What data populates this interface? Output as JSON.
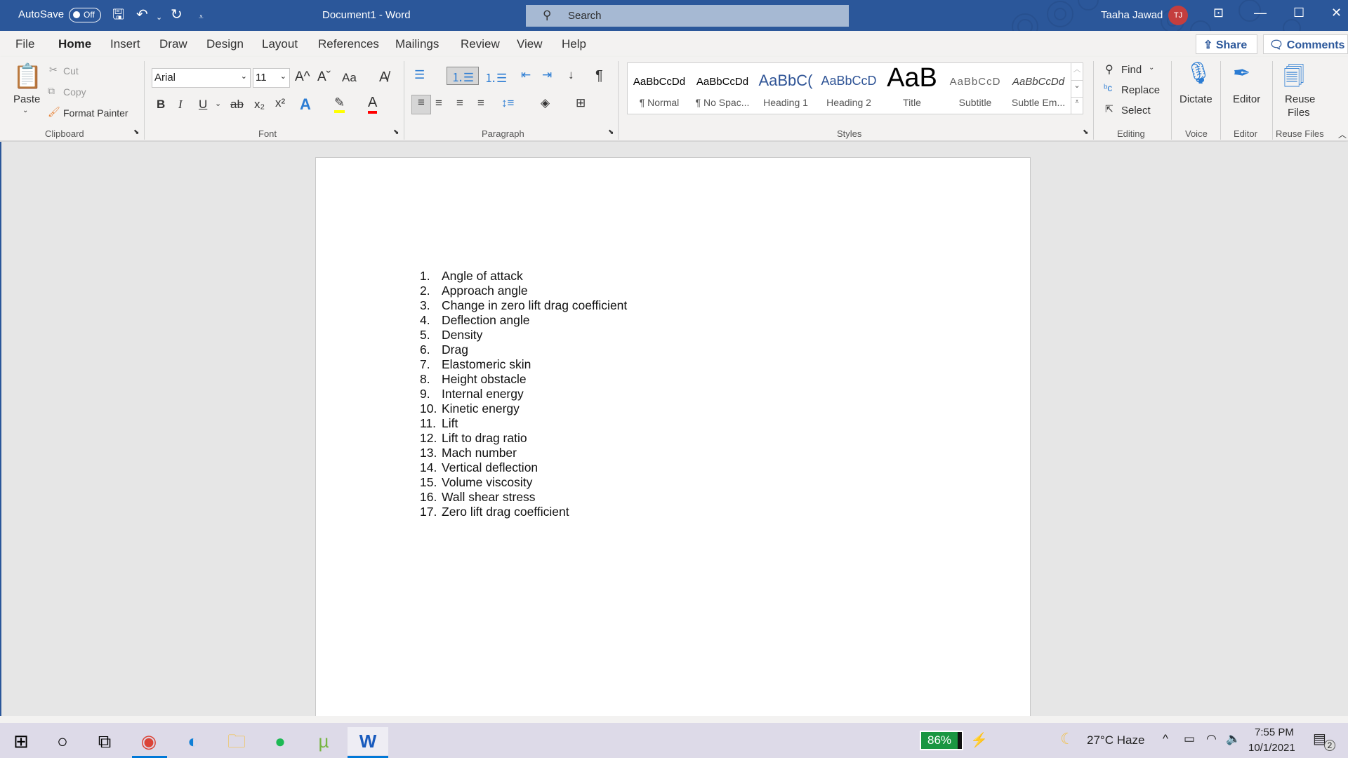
{
  "titlebar": {
    "autosave_label": "AutoSave",
    "autosave_state": "Off",
    "doc_title": "Document1  -  Word",
    "search_placeholder": "Search",
    "user_name": "Taaha Jawad",
    "user_initials": "TJ"
  },
  "menu": {
    "tabs": [
      "File",
      "Home",
      "Insert",
      "Draw",
      "Design",
      "Layout",
      "References",
      "Mailings",
      "Review",
      "View",
      "Help"
    ],
    "active_tab": "Home",
    "share_label": "Share",
    "comments_label": "Comments"
  },
  "ribbon": {
    "clipboard": {
      "paste": "Paste",
      "cut": "Cut",
      "copy": "Copy",
      "format_painter": "Format Painter",
      "label": "Clipboard"
    },
    "font": {
      "family": "Arial",
      "size": "11",
      "label": "Font",
      "grow": "A^",
      "shrink": "Aˇ",
      "case": "Aa",
      "bold": "B",
      "italic": "I",
      "underline": "U",
      "strike": "ab",
      "subscript": "x₂",
      "superscript": "x²"
    },
    "paragraph": {
      "label": "Paragraph"
    },
    "styles": {
      "label": "Styles",
      "items": [
        {
          "preview": "AaBbCcDd",
          "name": "¶ Normal"
        },
        {
          "preview": "AaBbCcDd",
          "name": "¶ No Spac..."
        },
        {
          "preview": "AaBbC(",
          "name": "Heading 1"
        },
        {
          "preview": "AaBbCcD",
          "name": "Heading 2"
        },
        {
          "preview": "AaB",
          "name": "Title"
        },
        {
          "preview": "AaBbCcD",
          "name": "Subtitle"
        },
        {
          "preview": "AaBbCcDd",
          "name": "Subtle Em..."
        }
      ]
    },
    "editing": {
      "find": "Find",
      "replace": "Replace",
      "select": "Select",
      "label": "Editing"
    },
    "voice": {
      "dictate": "Dictate",
      "label": "Voice"
    },
    "editor": {
      "editor": "Editor",
      "label": "Editor"
    },
    "reuse": {
      "line1": "Reuse",
      "line2": "Files",
      "label": "Reuse Files"
    }
  },
  "document": {
    "list": [
      "Angle of attack",
      "Approach angle",
      "Change in zero lift drag coefficient",
      "Deflection angle",
      "Density",
      "Drag",
      "Elastomeric skin",
      "Height obstacle",
      "Internal energy",
      "Kinetic energy",
      "Lift",
      "Lift to drag ratio",
      "Mach number",
      "Vertical deflection",
      "Volume viscosity",
      "Wall shear stress",
      "Zero lift drag coefficient"
    ]
  },
  "taskbar": {
    "battery": "86%",
    "weather": "27°C  Haze",
    "time": "7:55 PM",
    "date": "10/1/2021",
    "notifications": "2"
  },
  "colors": {
    "accent": "#2b579a",
    "avatar": "#c43e3e",
    "battery": "#1a9641"
  }
}
